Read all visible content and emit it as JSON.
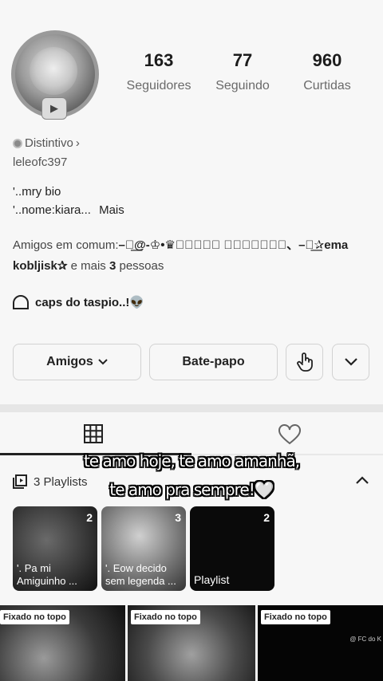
{
  "profile": {
    "followers": "163",
    "followers_label": "Seguidores",
    "following": "77",
    "following_label": "Seguindo",
    "likes": "960",
    "likes_label": "Curtidas",
    "badge_label": "Distintivo",
    "handle": "leleofc397",
    "bio_line1": "'..mry bio",
    "bio_line2": "'..nome:kiara...",
    "more_label": "Mais"
  },
  "friends": {
    "prefix": "Amigos em comum:",
    "names": "–⃝͟@-♔•♛𝄢𝑹𝒂𝒇𝒂 𝑩𝒆𝒓𝒕𝒓𝒂𝒏、–⃝͟✰ema kobljisk✰",
    "and_more": "e mais",
    "count": "3",
    "people": "pessoas"
  },
  "caps": {
    "text": "caps do taspio..!👽"
  },
  "buttons": {
    "friends": "Amigos",
    "chat": "Bate-papo"
  },
  "playlists": {
    "title": "3 Playlists",
    "items": [
      {
        "count": "2",
        "label": "'. Pa mi Amiguinho ..."
      },
      {
        "count": "3",
        "label": "'. Eow decido sem legenda ..."
      },
      {
        "count": "2",
        "label": "Playlist"
      }
    ]
  },
  "videos": {
    "pinned_label": "Fixado no topo",
    "watermark": "@ FC do K"
  },
  "caption": {
    "line1": "te amo hoje, te amo amanhã,",
    "line2": "te amo pra sempre!🤍"
  },
  "icons": [
    "grid-icon",
    "heart-icon",
    "playlist-icon",
    "chevron-up-icon",
    "chevron-down-icon",
    "hand-pointer-icon",
    "tent-icon",
    "badge-icon"
  ]
}
